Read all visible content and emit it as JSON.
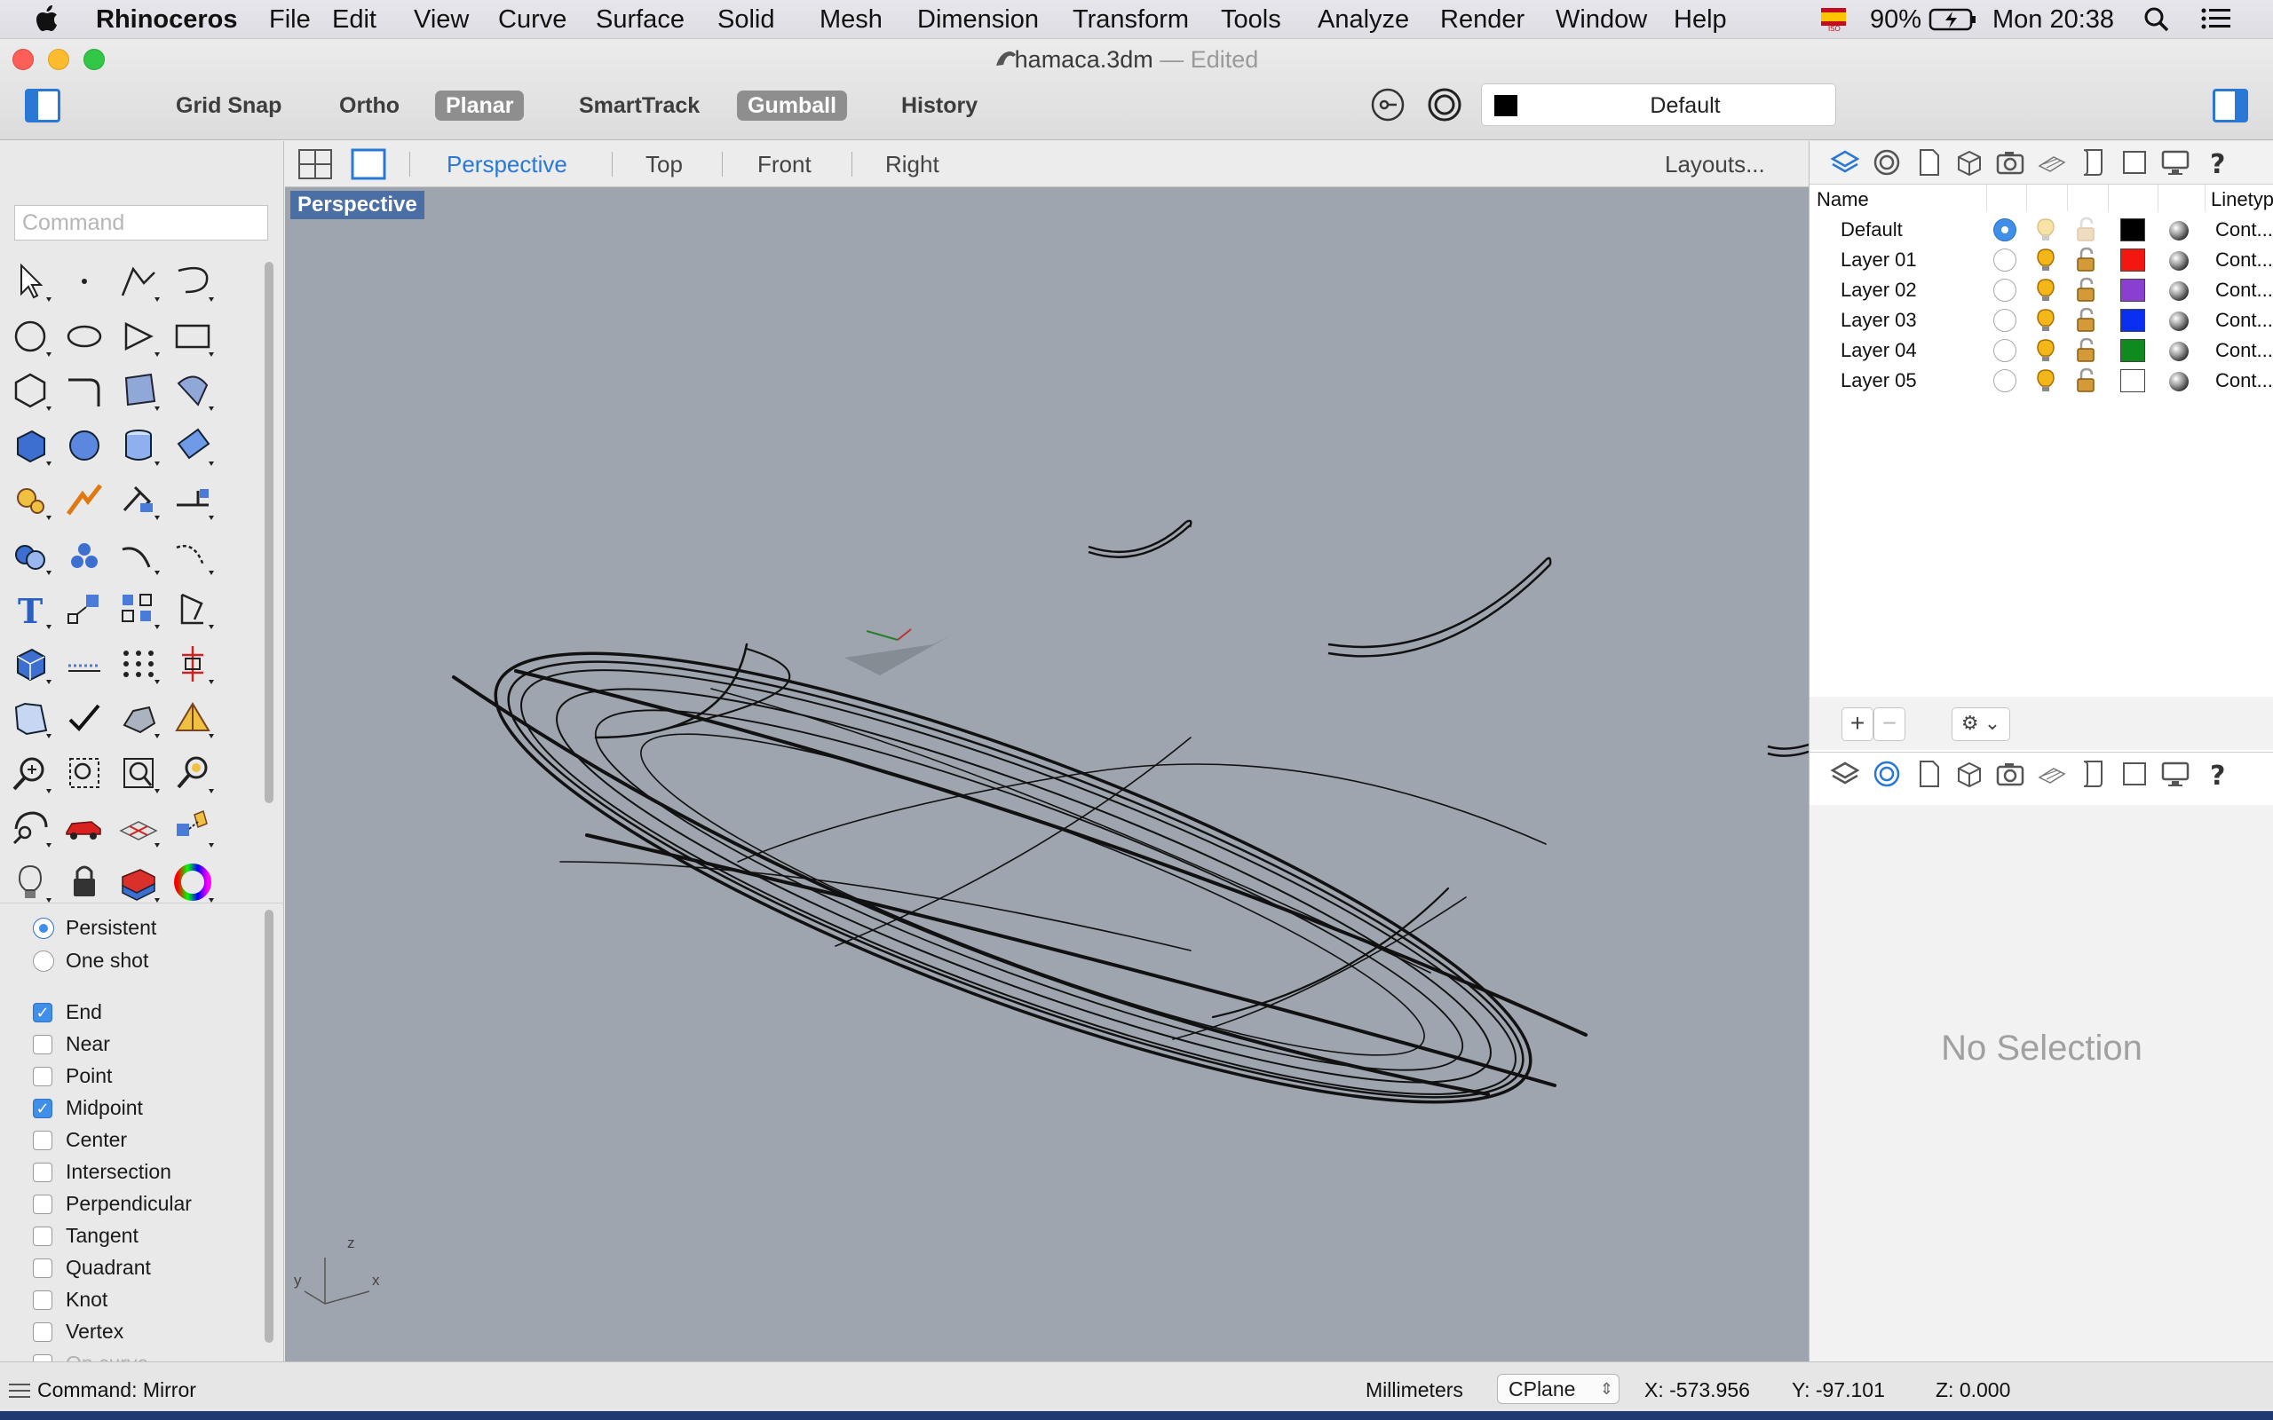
{
  "menubar": {
    "apple_icon": "apple-icon",
    "app_name": "Rhinoceros",
    "items": [
      "File",
      "Edit",
      "View",
      "Curve",
      "Surface",
      "Solid",
      "Mesh",
      "Dimension",
      "Transform",
      "Tools",
      "Analyze",
      "Render",
      "Window",
      "Help"
    ],
    "battery": "90%",
    "clock": "Mon 20:38",
    "input_source_icon": "spain-flag-icon"
  },
  "window": {
    "title": "hamaca.3dm",
    "title_sep": " — ",
    "title_status": "Edited"
  },
  "toolbar": {
    "buttons": [
      {
        "label": "Grid Snap",
        "on": false
      },
      {
        "label": "Ortho",
        "on": false
      },
      {
        "label": "Planar",
        "on": true
      },
      {
        "label": "SmartTrack",
        "on": false
      },
      {
        "label": "Gumball",
        "on": true
      },
      {
        "label": "History",
        "on": false
      }
    ],
    "current_layer": "Default",
    "current_layer_color": "#000000"
  },
  "command": {
    "placeholder": "Command",
    "last_command": "Command: Mirror"
  },
  "osnap": {
    "mode": [
      {
        "label": "Persistent",
        "selected": true
      },
      {
        "label": "One shot",
        "selected": false
      }
    ],
    "items": [
      {
        "label": "End",
        "checked": true
      },
      {
        "label": "Near",
        "checked": false
      },
      {
        "label": "Point",
        "checked": false
      },
      {
        "label": "Midpoint",
        "checked": true
      },
      {
        "label": "Center",
        "checked": false
      },
      {
        "label": "Intersection",
        "checked": false
      },
      {
        "label": "Perpendicular",
        "checked": false
      },
      {
        "label": "Tangent",
        "checked": false
      },
      {
        "label": "Quadrant",
        "checked": false
      },
      {
        "label": "Knot",
        "checked": false
      },
      {
        "label": "Vertex",
        "checked": false
      },
      {
        "label": "On curve",
        "checked": false,
        "disabled": true
      }
    ]
  },
  "viewports": {
    "tabs": [
      "Perspective",
      "Top",
      "Front",
      "Right"
    ],
    "active": "Perspective",
    "layouts_label": "Layouts...",
    "active_label": "Perspective",
    "axis_labels": {
      "x": "x",
      "y": "y",
      "z": "z"
    }
  },
  "layers": {
    "columns": {
      "name": "Name",
      "linetype": "Linetyp"
    },
    "rows": [
      {
        "name": "Default",
        "current": true,
        "on": false,
        "locked": false,
        "color": "#000000",
        "linetype": "Cont..."
      },
      {
        "name": "Layer 01",
        "current": false,
        "on": true,
        "locked": true,
        "color": "#f2170f",
        "linetype": "Cont..."
      },
      {
        "name": "Layer 02",
        "current": false,
        "on": true,
        "locked": true,
        "color": "#8a3fd1",
        "linetype": "Cont..."
      },
      {
        "name": "Layer 03",
        "current": false,
        "on": true,
        "locked": true,
        "color": "#0a2ff0",
        "linetype": "Cont..."
      },
      {
        "name": "Layer 04",
        "current": false,
        "on": true,
        "locked": true,
        "color": "#0e8a1f",
        "linetype": "Cont..."
      },
      {
        "name": "Layer 05",
        "current": false,
        "on": true,
        "locked": true,
        "color": "#ffffff",
        "linetype": "Cont..."
      }
    ],
    "add_label": "+",
    "remove_label": "−",
    "gear_label": "⚙ ⌄"
  },
  "properties": {
    "empty_text": "No Selection"
  },
  "status": {
    "units": "Millimeters",
    "cplane": "CPlane",
    "x": "X: -573.956",
    "y": "Y: -97.101",
    "z": "Z: 0.000"
  }
}
